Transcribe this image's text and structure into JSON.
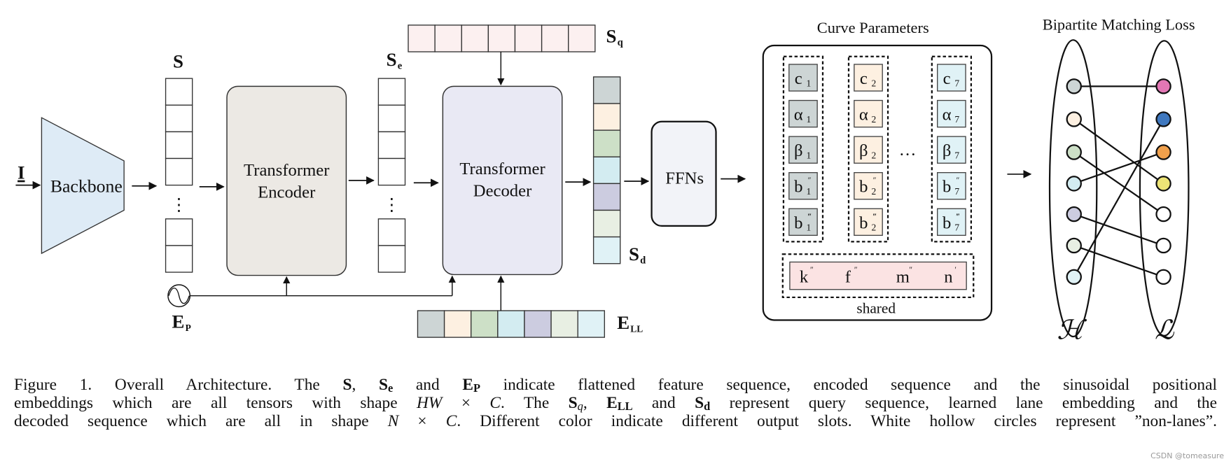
{
  "colors": {
    "slots": [
      "#cdd5d5",
      "#fdf0e1",
      "#cde0c7",
      "#d3ecf1",
      "#cccce0",
      "#e8efe3",
      "#e0f2f6"
    ],
    "lanes": [
      "#e377b5",
      "#3f78bf",
      "#f0a04c",
      "#ede476",
      "#ffffff",
      "#ffffff",
      "#ffffff"
    ],
    "query": "#fcf0f0",
    "shared": "#fbe3e3",
    "backbone": "#deebf6",
    "encoder": "#ece9e4",
    "decoder": "#e9e9f4",
    "ffn": "#f2f3f8"
  },
  "diagram": {
    "input_label": "I",
    "backbone_label": "Backbone",
    "s_label": {
      "main": "S",
      "sub": ""
    },
    "se_label": {
      "main": "S",
      "sub": "e"
    },
    "sq_label": {
      "main": "S",
      "sub": "q"
    },
    "sd_label": {
      "main": "S",
      "sub": "d"
    },
    "ep_label": {
      "main": "E",
      "sub": "P"
    },
    "ell_label": {
      "main": "E",
      "sub": "LL"
    },
    "seq_dots": "⋮",
    "encoder_label": [
      "Transformer",
      "Encoder"
    ],
    "decoder_label": [
      "Transformer",
      "Decoder"
    ],
    "ffn_label": "FFNs",
    "curve_params": {
      "title": "Curve Parameters",
      "groups": [
        [
          {
            "s": "c",
            "sub": "1",
            "sup": ""
          },
          {
            "s": "α",
            "sub": "1",
            "sup": ""
          },
          {
            "s": "β",
            "sub": "1",
            "sup": ""
          },
          {
            "s": "b",
            "sub": "1",
            "sup": "″"
          },
          {
            "s": "b",
            "sub": "1",
            "sup": "‴"
          }
        ],
        [
          {
            "s": "c",
            "sub": "2",
            "sup": ""
          },
          {
            "s": "α",
            "sub": "2",
            "sup": ""
          },
          {
            "s": "β",
            "sub": "2",
            "sup": ""
          },
          {
            "s": "b",
            "sub": "2",
            "sup": "″"
          },
          {
            "s": "b",
            "sub": "2",
            "sup": "‴"
          }
        ],
        [
          {
            "s": "c",
            "sub": "7",
            "sup": ""
          },
          {
            "s": "α",
            "sub": "7",
            "sup": ""
          },
          {
            "s": "β",
            "sub": "7",
            "sup": ""
          },
          {
            "s": "b",
            "sub": "7",
            "sup": "″"
          },
          {
            "s": "b",
            "sub": "7",
            "sup": "‴"
          }
        ]
      ],
      "ellipsis": "…",
      "shared_params": [
        {
          "s": "k",
          "sup": "″"
        },
        {
          "s": "f",
          "sup": "″"
        },
        {
          "s": "m",
          "sup": "″"
        },
        {
          "s": "n",
          "sup": "′"
        }
      ],
      "shared_label": "shared"
    },
    "matching": {
      "title": "Bipartite Matching Loss",
      "left_set": "ℋ",
      "right_set": "ℒ",
      "pairs": [
        [
          1,
          1
        ],
        [
          2,
          4
        ],
        [
          3,
          5
        ],
        [
          4,
          3
        ],
        [
          5,
          6
        ],
        [
          6,
          7
        ],
        [
          7,
          2
        ]
      ]
    }
  },
  "caption": {
    "lines": [
      [
        {
          "t": "Figure 1. Overall Architecture.  The "
        },
        {
          "t": "S",
          "b": true
        },
        {
          "t": ", "
        },
        {
          "t": "S",
          "b": true,
          "sub": "e"
        },
        {
          "t": " and "
        },
        {
          "t": "E",
          "b": true,
          "sub": "P"
        },
        {
          "t": " indicate flattened feature sequence, encoded sequence and the sinusoidal positional"
        }
      ],
      [
        {
          "t": "embeddings which are all tensors with shape "
        },
        {
          "t": "HW",
          "i": true
        },
        {
          "t": " × "
        },
        {
          "t": "C",
          "i": true
        },
        {
          "t": ". The "
        },
        {
          "t": "S",
          "b": true,
          "sub": "q",
          "subi": true
        },
        {
          "t": ", "
        },
        {
          "t": "E",
          "b": true,
          "sub": "LL"
        },
        {
          "t": " and "
        },
        {
          "t": "S",
          "b": true,
          "sub": "d"
        },
        {
          "t": " represent query sequence, learned lane embedding and the"
        }
      ],
      [
        {
          "t": "decoded sequence which are all in shape "
        },
        {
          "t": "N",
          "i": true
        },
        {
          "t": " × "
        },
        {
          "t": "C",
          "i": true
        },
        {
          "t": ". Different color indicate different output slots. White hollow circles represent ”non-lanes”."
        }
      ]
    ]
  },
  "watermark": "CSDN @tomeasure"
}
